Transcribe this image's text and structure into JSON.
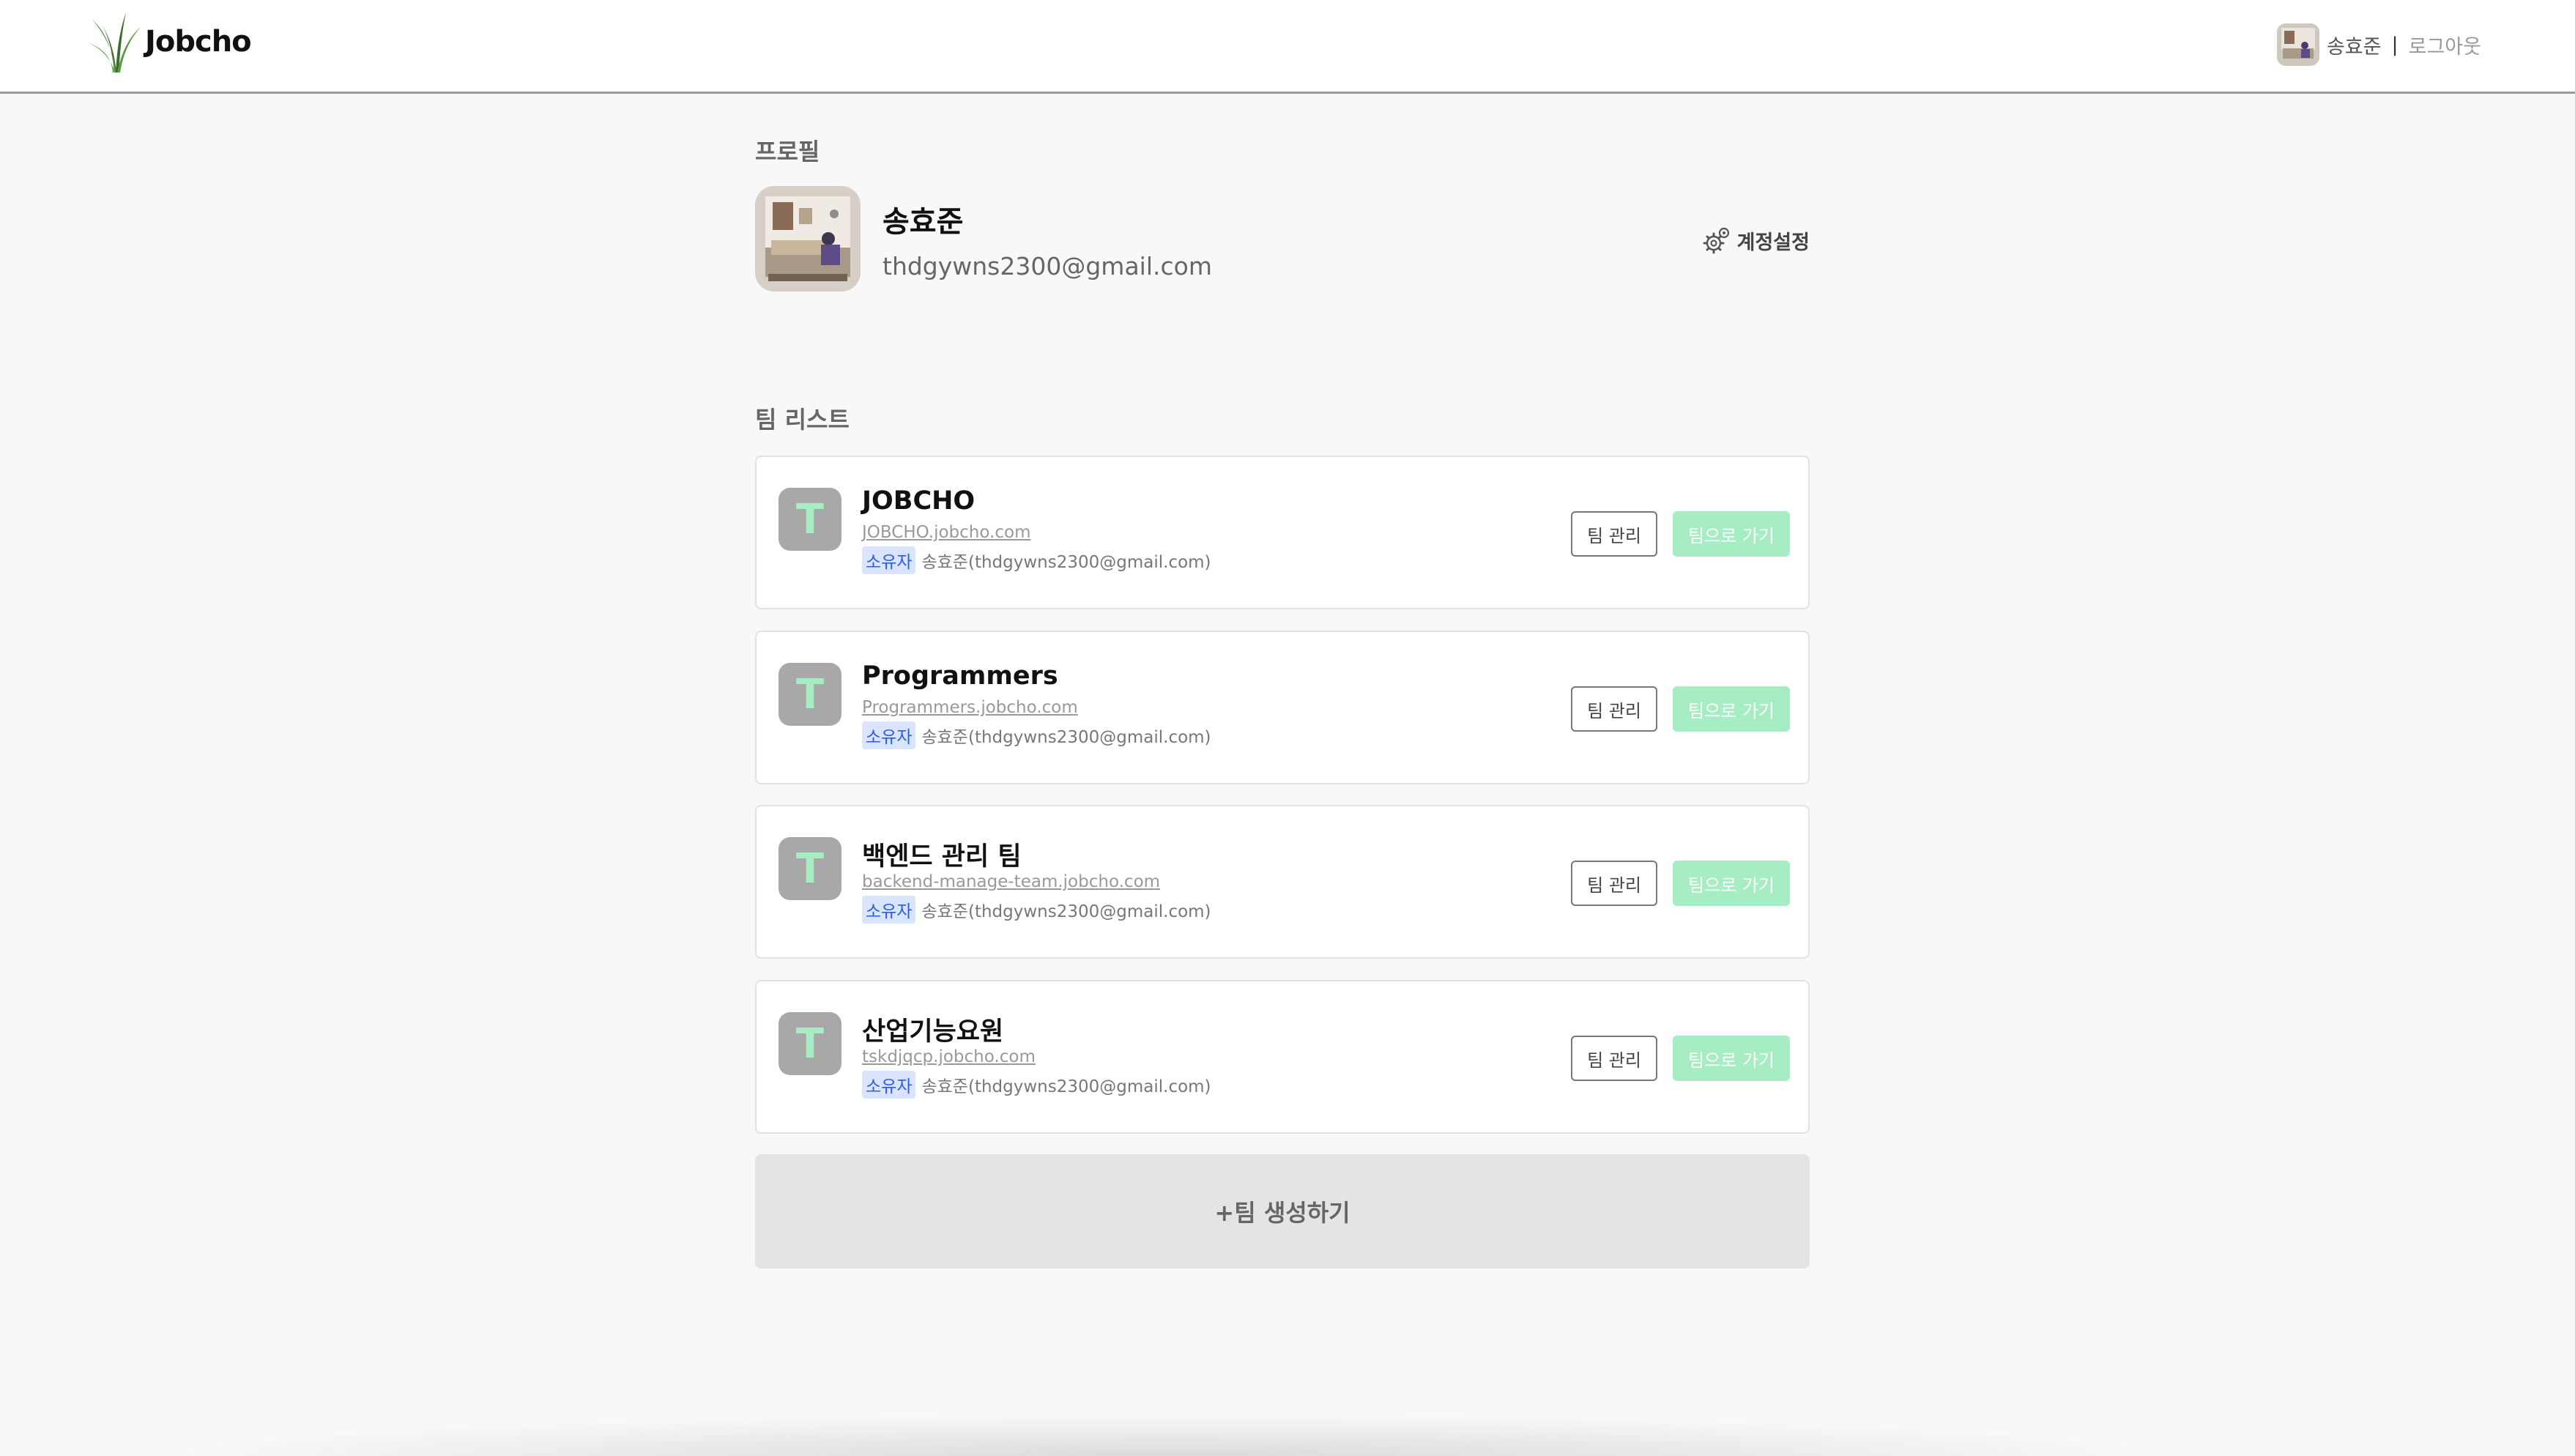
{
  "header": {
    "brand": "Jobcho",
    "user_name": "송효준",
    "separator": "|",
    "logout_label": "로그아웃"
  },
  "profile": {
    "section_title": "프로필",
    "name": "송효준",
    "email": "thdgywns2300@gmail.com",
    "settings_label": "계정설정"
  },
  "teams": {
    "section_title": "팀 리스트",
    "manage_label": "팀 관리",
    "go_label": "팀으로 가기",
    "owner_badge": "소유자",
    "items": [
      {
        "initial": "T",
        "name": "JOBCHO",
        "domain": "JOBCHO.jobcho.com",
        "owner": "송효준(thdgywns2300@gmail.com)"
      },
      {
        "initial": "T",
        "name": "Programmers",
        "domain": "Programmers.jobcho.com",
        "owner": "송효준(thdgywns2300@gmail.com)"
      },
      {
        "initial": "T",
        "name": "백엔드 관리 팀",
        "domain": "backend-manage-team.jobcho.com",
        "owner": "송효준(thdgywns2300@gmail.com)"
      },
      {
        "initial": "T",
        "name": "산업기능요원",
        "domain": "tskdjqcp.jobcho.com",
        "owner": "송효준(thdgywns2300@gmail.com)"
      }
    ],
    "create_label": "+팀 생성하기"
  },
  "colors": {
    "accent_green": "#a7edc4",
    "owner_badge_bg": "#d9e4ff",
    "owner_badge_text": "#2d5be3",
    "team_icon_bg": "#a8a8a8"
  }
}
